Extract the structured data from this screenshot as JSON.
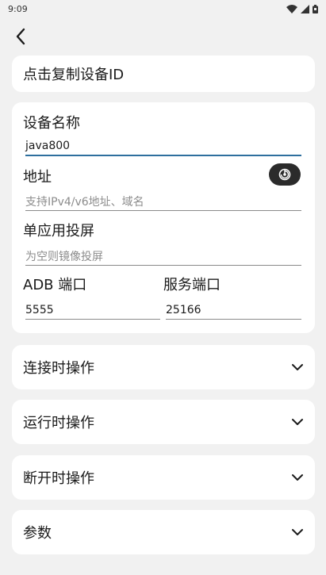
{
  "status_bar": {
    "time": "9:09"
  },
  "copy_id": {
    "label": "点击复制设备ID"
  },
  "form": {
    "device_name": {
      "label": "设备名称",
      "value": "java800"
    },
    "address": {
      "label": "地址",
      "placeholder": "支持IPv4/v6地址、域名"
    },
    "single_app": {
      "label": "单应用投屏",
      "placeholder": "为空则镜像投屏"
    },
    "adb_port": {
      "label": "ADB 端口",
      "value": "5555"
    },
    "service_port": {
      "label": "服务端口",
      "value": "25166"
    }
  },
  "sections": [
    {
      "label": "连接时操作"
    },
    {
      "label": "运行时操作"
    },
    {
      "label": "断开时操作"
    },
    {
      "label": "参数"
    }
  ],
  "icons": {
    "back": "arrow-back-icon",
    "scan": "scan-icon",
    "expand": "chevron-down-icon"
  }
}
